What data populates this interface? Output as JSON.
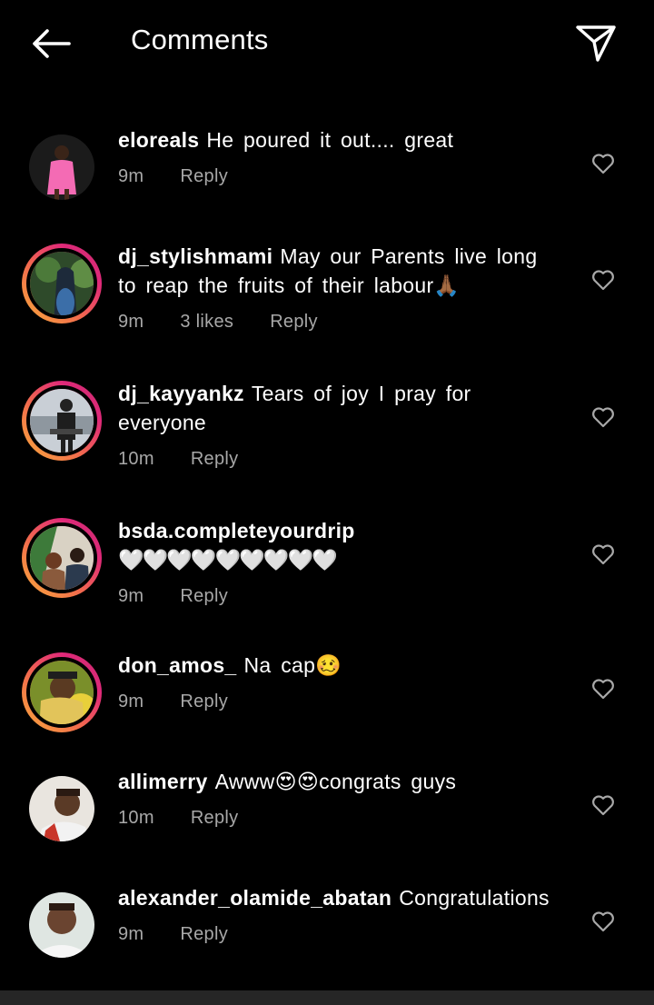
{
  "header": {
    "title": "Comments",
    "back_icon": "arrow-left-icon",
    "share_icon": "paper-plane-icon"
  },
  "comments": [
    {
      "username": "eloreals",
      "text": "He poured it out.... great",
      "time": "9m",
      "likes": "",
      "reply": "Reply",
      "story_ring": false
    },
    {
      "username": "dj_stylishmami",
      "text": "May our Parents live long to reap the fruits of their labour🙏🏾",
      "time": "9m",
      "likes": "3 likes",
      "reply": "Reply",
      "story_ring": true
    },
    {
      "username": "dj_kayyankz",
      "text": "Tears of joy I pray for everyone",
      "time": "10m",
      "likes": "",
      "reply": "Reply",
      "story_ring": true
    },
    {
      "username": "bsda.completeyourdrip",
      "text": "🤍🤍🤍🤍🤍🤍🤍🤍🤍",
      "time": "9m",
      "likes": "",
      "reply": "Reply",
      "story_ring": true
    },
    {
      "username": "don_amos_",
      "text": "Na cap🥴",
      "time": "9m",
      "likes": "",
      "reply": "Reply",
      "story_ring": true
    },
    {
      "username": "allimerry",
      "text": "Awww😍😍congrats guys",
      "time": "10m",
      "likes": "",
      "reply": "Reply",
      "story_ring": false
    },
    {
      "username": "alexander_olamide_abatan",
      "text": "Congratulations",
      "time": "9m",
      "likes": "",
      "reply": "Reply",
      "story_ring": false
    }
  ],
  "colors": {
    "background": "#000000",
    "meta_text": "#a8a8a8",
    "story_ring_start": "#f9ad3b",
    "story_ring_end": "#c6306c"
  }
}
